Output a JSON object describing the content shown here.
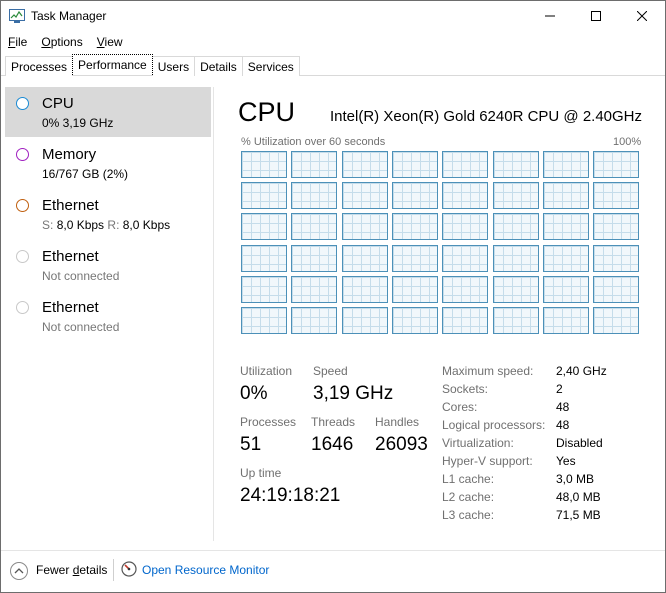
{
  "window": {
    "title": "Task Manager"
  },
  "menu": {
    "file": {
      "label": "File",
      "accel": "F",
      "rest": "ile"
    },
    "options": {
      "label": "Options",
      "accel": "O",
      "rest": "ptions"
    },
    "view": {
      "label": "View",
      "accel": "V",
      "rest": "iew"
    }
  },
  "tabs": [
    "Processes",
    "Performance",
    "Users",
    "Details",
    "Services"
  ],
  "active_tab": "Performance",
  "sidebar": {
    "items": [
      {
        "name": "CPU",
        "sub": "0% 3,19 GHz",
        "circle_color": "#1a8ad4"
      },
      {
        "name": "Memory",
        "sub": "16/767 GB (2%)",
        "circle_color": "#a020c0"
      },
      {
        "name": "Ethernet",
        "sub_send_label": "S:",
        "sub_send": "8,0 Kbps",
        "sub_recv_label": "R:",
        "sub_recv": "8,0 Kbps",
        "circle_color": "#c06010"
      },
      {
        "name": "Ethernet",
        "sub": "Not connected",
        "circle_color": "#b0b0b0"
      },
      {
        "name": "Ethernet",
        "sub": "Not connected",
        "circle_color": "#b0b0b0"
      }
    ]
  },
  "cpu": {
    "title": "CPU",
    "model": "Intel(R) Xeon(R) Gold 6240R CPU @ 2.40GHz",
    "graph_caption": "% Utilization over 60 seconds",
    "graph_max": "100%",
    "graph_rows": 6,
    "graph_cols": 8,
    "stats": {
      "utilization_label": "Utilization",
      "utilization": "0%",
      "speed_label": "Speed",
      "speed": "3,19 GHz",
      "processes_label": "Processes",
      "processes": "51",
      "threads_label": "Threads",
      "threads": "1646",
      "handles_label": "Handles",
      "handles": "26093",
      "uptime_label": "Up time",
      "uptime": "24:19:18:21"
    },
    "specs": [
      {
        "label": "Maximum speed:",
        "value": "2,40 GHz"
      },
      {
        "label": "Sockets:",
        "value": "2"
      },
      {
        "label": "Cores:",
        "value": "48"
      },
      {
        "label": "Logical processors:",
        "value": "48"
      },
      {
        "label": "Virtualization:",
        "value": "Disabled"
      },
      {
        "label": "Hyper-V support:",
        "value": "Yes"
      },
      {
        "label": "L1 cache:",
        "value": "3,0 MB"
      },
      {
        "label": "L2 cache:",
        "value": "48,0 MB"
      },
      {
        "label": "L3 cache:",
        "value": "71,5 MB"
      }
    ]
  },
  "footer": {
    "fewer_details": "Fewer details",
    "fewer_accel_pre": "Fewer ",
    "fewer_accel": "d",
    "fewer_accel_post": "etails",
    "open_resource_monitor": "Open Resource Monitor"
  }
}
